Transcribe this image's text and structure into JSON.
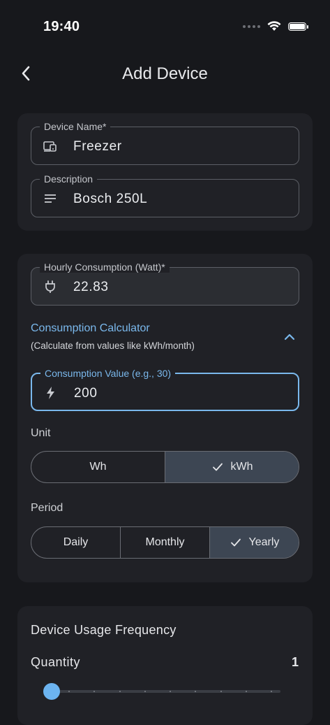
{
  "status": {
    "time": "19:40"
  },
  "header": {
    "title": "Add Device"
  },
  "device": {
    "name_label": "Device Name*",
    "name_value": "Freezer",
    "description_label": "Description",
    "description_value": "Bosch 250L"
  },
  "consumption": {
    "hourly_label": "Hourly Consumption (Watt)*",
    "hourly_value": "22.83",
    "calculator_title": "Consumption Calculator",
    "calculator_subtitle": "(Calculate from values like kWh/month)",
    "value_label": "Consumption Value (e.g., 30)",
    "value": "200",
    "unit_label": "Unit",
    "unit_options": [
      {
        "label": "Wh",
        "selected": false
      },
      {
        "label": "kWh",
        "selected": true
      }
    ],
    "period_label": "Period",
    "period_options": [
      {
        "label": "Daily",
        "selected": false
      },
      {
        "label": "Monthly",
        "selected": false
      },
      {
        "label": "Yearly",
        "selected": true
      }
    ]
  },
  "usage": {
    "title": "Device Usage Frequency",
    "quantity_label": "Quantity",
    "quantity_value": "1",
    "quantity_slider": {
      "value": 1,
      "min": 1,
      "max": 10
    }
  },
  "colors": {
    "background": "#17181c",
    "card": "#202126",
    "accent": "#7ab8ec",
    "selected_segment": "#3d4653"
  }
}
